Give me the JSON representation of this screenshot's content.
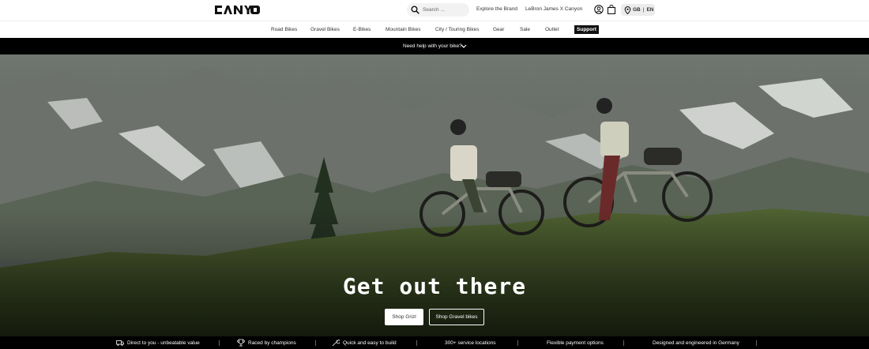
{
  "header": {
    "logo_text": "CANYON",
    "search": {
      "placeholder": "Search ..."
    },
    "links": {
      "explore": "Explore the Brand",
      "collab": "LeBron James X Canyon"
    },
    "locale": {
      "country": "GB",
      "language": "EN"
    },
    "icons": {
      "account": "user-icon",
      "bag": "bag-icon",
      "pin": "location-pin-icon",
      "search": "search-icon"
    }
  },
  "nav": {
    "items": [
      "Road Bikes",
      "Gravel Bikes",
      "E-Bikes",
      "Mountain Bikes",
      "City / Touring Bikes",
      "Gear",
      "Sale",
      "Outlet"
    ],
    "support": "Support"
  },
  "helpbar": {
    "text": "Need help with your bike?"
  },
  "hero": {
    "headline": "Get out there",
    "primary_cta": "Shop Grizl",
    "secondary_cta": "Shop Gravel bikes"
  },
  "usps": [
    "Direct to you - unbeatable value",
    "Raced by champions",
    "Quick and easy to build",
    "300+ service locations",
    "Flexible payment options",
    "Designed and engineered in Germany"
  ],
  "colors": {
    "brand_black": "#000000",
    "header_bg": "#ffffff",
    "support_bg": "#111111"
  }
}
